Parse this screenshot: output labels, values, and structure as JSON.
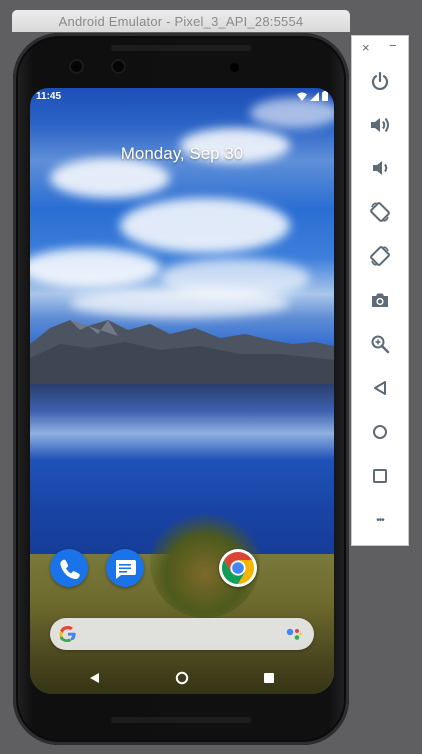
{
  "window": {
    "title": "Android Emulator - Pixel_3_API_28:5554"
  },
  "status_bar": {
    "time": "11:45",
    "icons": [
      "wifi-icon",
      "signal-icon",
      "battery-icon"
    ]
  },
  "lock_screen": {
    "date": "Monday, Sep 30"
  },
  "dock": {
    "apps": [
      {
        "name": "Phone",
        "icon": "phone-icon",
        "color": "#1a73e8"
      },
      {
        "name": "Messages",
        "icon": "messages-icon",
        "color": "#1a73e8"
      },
      {
        "name": "Chrome",
        "icon": "chrome-icon",
        "color": "#ffffff"
      }
    ]
  },
  "search": {
    "icon_left": "google-g-icon",
    "icon_right": "google-assistant-icon"
  },
  "nav_bar": {
    "buttons": [
      "back-icon",
      "home-icon",
      "overview-icon"
    ]
  },
  "toolbar": {
    "close_glyph": "×",
    "minimize_glyph": "−",
    "more_glyph": "•••",
    "buttons": [
      "power-icon",
      "volume-up-icon",
      "volume-down-icon",
      "rotate-left-icon",
      "rotate-right-icon",
      "camera-icon",
      "zoom-icon",
      "back-icon",
      "home-icon",
      "overview-icon",
      "more-icon"
    ]
  },
  "colors": {
    "toolbar_icon": "#5c6b76",
    "accent_blue": "#1a73e8",
    "window_bg": "#5f5f62"
  }
}
